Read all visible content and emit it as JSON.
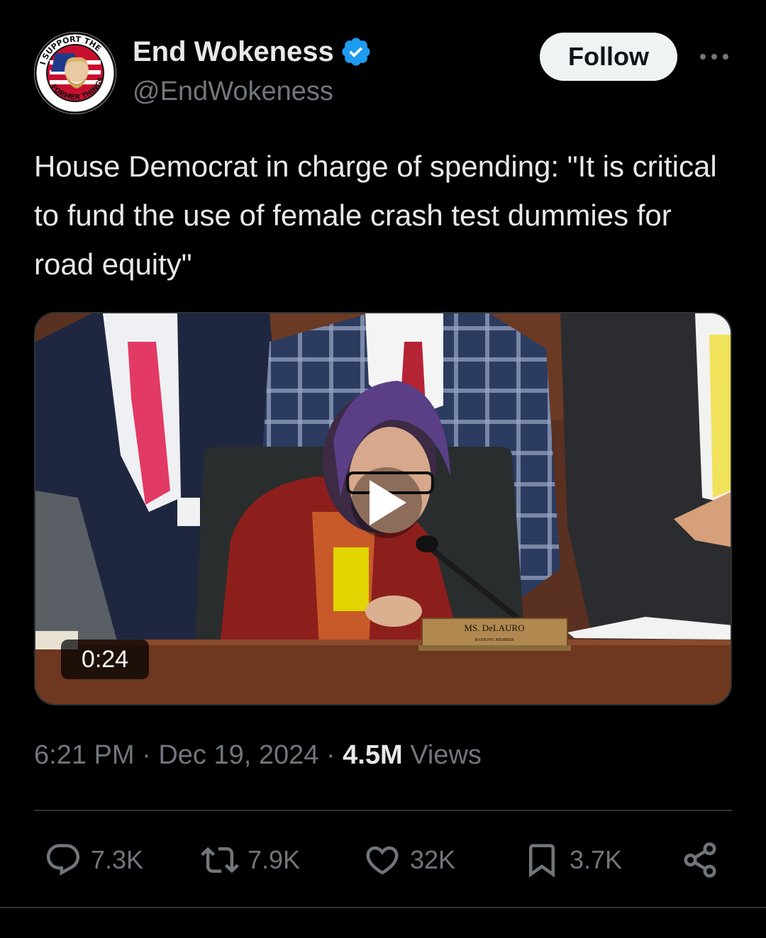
{
  "author": {
    "display_name": "End Wokeness",
    "handle": "@EndWokeness",
    "verified": true,
    "avatar_icon": "support-the-former-things-badge-icon",
    "avatar_text_top": "I SUPPORT THE",
    "avatar_text_bottom": "FORMER THINGS"
  },
  "follow_button": {
    "label": "Follow"
  },
  "more_icon": "more-horizontal-icon",
  "tweet": {
    "text": "House Democrat in charge of spending: \"It is critical to fund the use of female crash test dummies for road equity\""
  },
  "media": {
    "type": "video",
    "duration": "0:24",
    "nameplate": {
      "name": "MS. DeLAURO",
      "title": "RANKING MEMBER"
    }
  },
  "meta": {
    "time": "6:21 PM",
    "separator": "·",
    "date": "Dec 19, 2024",
    "separator2": "·",
    "views_count": "4.5M",
    "views_label": "Views"
  },
  "actions": {
    "reply": {
      "icon": "reply-icon",
      "count": "7.3K"
    },
    "repost": {
      "icon": "repost-icon",
      "count": "7.9K"
    },
    "like": {
      "icon": "like-icon",
      "count": "32K"
    },
    "bookmark": {
      "icon": "bookmark-icon",
      "count": "3.7K"
    },
    "share": {
      "icon": "share-icon"
    }
  },
  "colors": {
    "background": "#000000",
    "text_primary": "#e7e9ea",
    "text_secondary": "#71767b",
    "verified_blue": "#1d9bf0",
    "divider": "#2f3336"
  }
}
